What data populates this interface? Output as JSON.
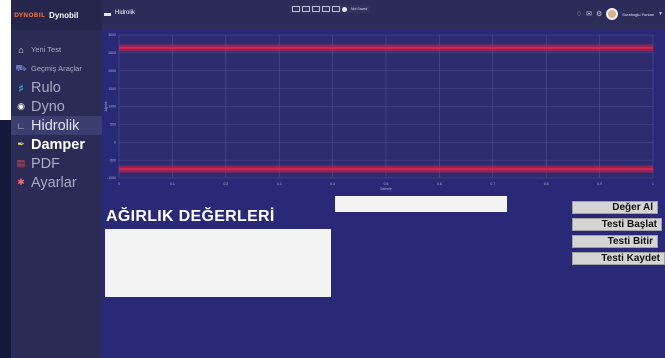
{
  "brand": {
    "logo_text": "DYNOBIL",
    "name": "Dynobil"
  },
  "sidebar": {
    "items": [
      {
        "label": "Yeni Test",
        "icon": "home-icon"
      },
      {
        "label": "Geçmiş Araçlar",
        "icon": "car-icon"
      },
      {
        "label": "Rulo",
        "icon": "rulo-icon"
      },
      {
        "label": "Dyno",
        "icon": "dyno-icon"
      },
      {
        "label": "Hidrolik",
        "icon": "chart-icon"
      },
      {
        "label": "Damper",
        "icon": "pen-icon"
      },
      {
        "label": "PDF",
        "icon": "pdf-icon"
      },
      {
        "label": "Ayarlar",
        "icon": "gear-icon"
      }
    ]
  },
  "topbar": {
    "title": "Hidrolik",
    "toolbar_text": "Not Saved",
    "user_name": "Surahoglu Furkan"
  },
  "chart_data": {
    "type": "line",
    "xlabel": "Sample",
    "ylabel": "Ağırlık",
    "xlim": [
      0,
      1
    ],
    "ylim": [
      -1000,
      3000
    ],
    "x_ticks": [
      "0",
      "0.1",
      "0.2",
      "0.3",
      "0.4",
      "0.5",
      "0.6",
      "0.7",
      "0.8",
      "0.9",
      "1"
    ],
    "y_ticks": [
      "3000",
      "2500",
      "2000",
      "1500",
      "1000",
      "500",
      "0",
      "-500",
      "-1000"
    ],
    "grid": true,
    "series": [
      {
        "values": [
          2640,
          2640
        ],
        "x": [
          0,
          1
        ],
        "color": "#d8234b"
      },
      {
        "values": [
          -750,
          -750
        ],
        "x": [
          0,
          1
        ],
        "color": "#d8234b"
      }
    ]
  },
  "weights": {
    "title": "AĞIRLIK DEĞERLERİ"
  },
  "value_field": {
    "value": ""
  },
  "buttons": {
    "get_value": "Değer Al",
    "start_test": "Testi Başlat",
    "end_test": "Testi Bitir",
    "save_test": "Testi Kaydet"
  },
  "colors": {
    "sidebar": "#2a2c55",
    "main": "#2a2977",
    "chart_bg": "#2c2c6e",
    "series": "#d8234b",
    "grid": "#4e5197"
  }
}
